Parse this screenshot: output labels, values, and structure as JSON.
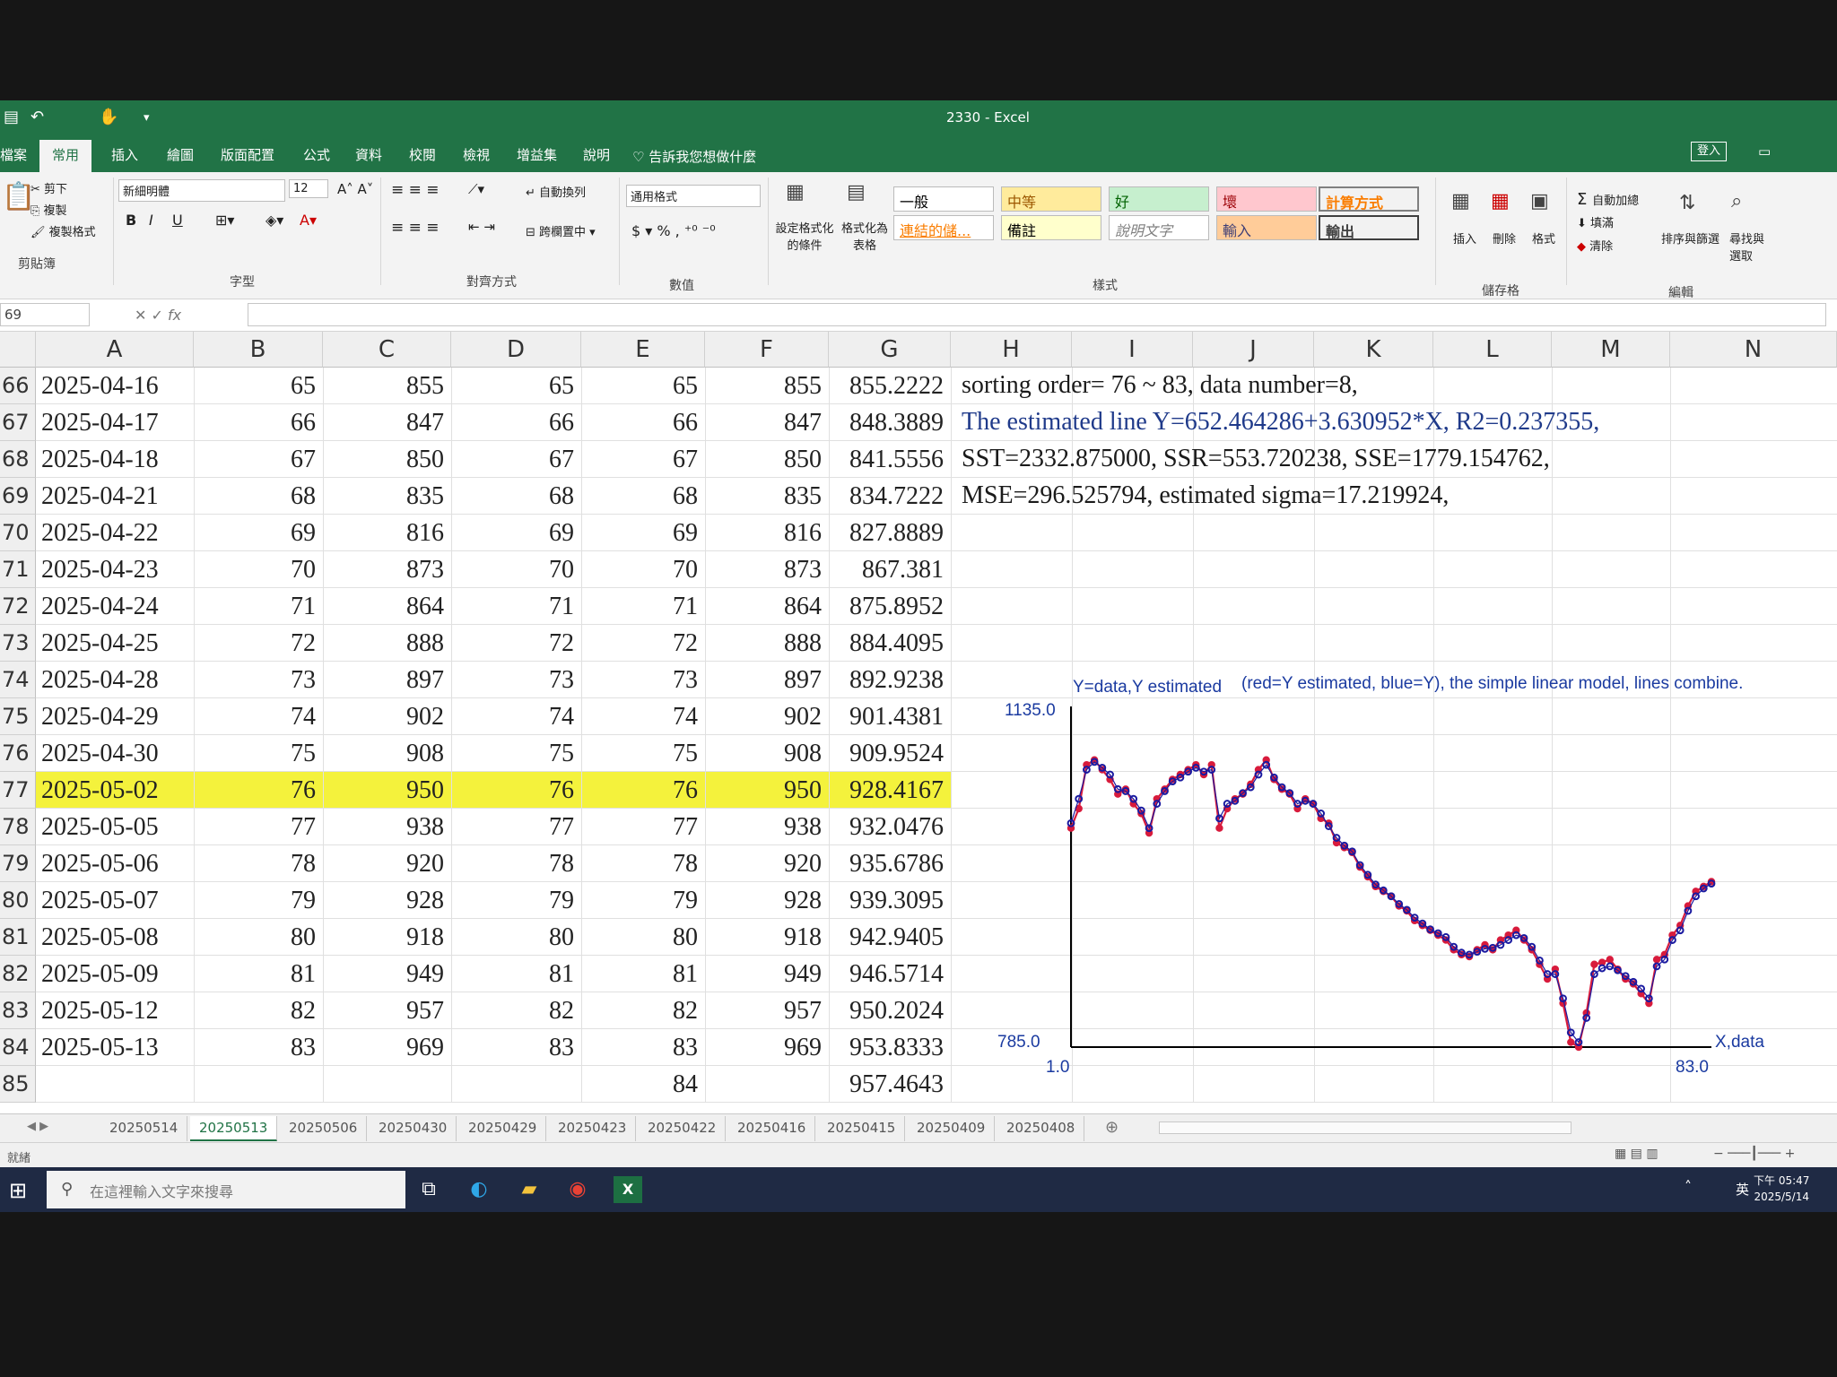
{
  "title_bar": {
    "title": "2330  -  Excel",
    "login": "登入"
  },
  "ribbon_tabs": [
    "檔案",
    "常用",
    "插入",
    "繪圖",
    "版面配置",
    "公式",
    "資料",
    "校閱",
    "檢視",
    "增益集",
    "說明"
  ],
  "tell_me": "告訴我您想做什麼",
  "clipboard": {
    "cut": "剪下",
    "copy": "複製",
    "format_painter": "複製格式",
    "label": "剪貼簿"
  },
  "font": {
    "name": "新細明體",
    "size": "12",
    "label": "字型"
  },
  "alignment": {
    "wrap": "自動換列",
    "merge": "跨欄置中",
    "label": "對齊方式"
  },
  "number": {
    "format": "通用格式",
    "label": "數值"
  },
  "styles": {
    "cond_format": "設定格式化的條件",
    "format_table": "格式化為表格",
    "cells": [
      "一般",
      "中等",
      "好",
      "壞",
      "計算方式",
      "連結的儲...",
      "備註",
      "說明文字",
      "輸入",
      "輸出"
    ],
    "label": "樣式"
  },
  "cells_group": {
    "insert": "插入",
    "delete": "刪除",
    "format": "格式",
    "label": "儲存格"
  },
  "editing": {
    "autosum": "自動加總",
    "fill": "填滿",
    "clear": "清除",
    "sort": "排序與篩選",
    "find": "尋找與選取",
    "label": "編輯"
  },
  "name_box": "69",
  "columns": [
    "A",
    "B",
    "C",
    "D",
    "E",
    "F",
    "G",
    "H",
    "I",
    "J",
    "K",
    "L",
    "M",
    "N"
  ],
  "rows": [
    {
      "n": "66",
      "a": "2025-04-16",
      "b": "65",
      "c": "855",
      "d": "65",
      "e": "65",
      "f": "855",
      "g": "855.2222"
    },
    {
      "n": "67",
      "a": "2025-04-17",
      "b": "66",
      "c": "847",
      "d": "66",
      "e": "66",
      "f": "847",
      "g": "848.3889"
    },
    {
      "n": "68",
      "a": "2025-04-18",
      "b": "67",
      "c": "850",
      "d": "67",
      "e": "67",
      "f": "850",
      "g": "841.5556"
    },
    {
      "n": "69",
      "a": "2025-04-21",
      "b": "68",
      "c": "835",
      "d": "68",
      "e": "68",
      "f": "835",
      "g": "834.7222"
    },
    {
      "n": "70",
      "a": "2025-04-22",
      "b": "69",
      "c": "816",
      "d": "69",
      "e": "69",
      "f": "816",
      "g": "827.8889"
    },
    {
      "n": "71",
      "a": "2025-04-23",
      "b": "70",
      "c": "873",
      "d": "70",
      "e": "70",
      "f": "873",
      "g": "867.381"
    },
    {
      "n": "72",
      "a": "2025-04-24",
      "b": "71",
      "c": "864",
      "d": "71",
      "e": "71",
      "f": "864",
      "g": "875.8952"
    },
    {
      "n": "73",
      "a": "2025-04-25",
      "b": "72",
      "c": "888",
      "d": "72",
      "e": "72",
      "f": "888",
      "g": "884.4095"
    },
    {
      "n": "74",
      "a": "2025-04-28",
      "b": "73",
      "c": "897",
      "d": "73",
      "e": "73",
      "f": "897",
      "g": "892.9238"
    },
    {
      "n": "75",
      "a": "2025-04-29",
      "b": "74",
      "c": "902",
      "d": "74",
      "e": "74",
      "f": "902",
      "g": "901.4381"
    },
    {
      "n": "76",
      "a": "2025-04-30",
      "b": "75",
      "c": "908",
      "d": "75",
      "e": "75",
      "f": "908",
      "g": "909.9524"
    },
    {
      "n": "77",
      "a": "2025-05-02",
      "b": "76",
      "c": "950",
      "d": "76",
      "e": "76",
      "f": "950",
      "g": "928.4167"
    },
    {
      "n": "78",
      "a": "2025-05-05",
      "b": "77",
      "c": "938",
      "d": "77",
      "e": "77",
      "f": "938",
      "g": "932.0476"
    },
    {
      "n": "79",
      "a": "2025-05-06",
      "b": "78",
      "c": "920",
      "d": "78",
      "e": "78",
      "f": "920",
      "g": "935.6786"
    },
    {
      "n": "80",
      "a": "2025-05-07",
      "b": "79",
      "c": "928",
      "d": "79",
      "e": "79",
      "f": "928",
      "g": "939.3095"
    },
    {
      "n": "81",
      "a": "2025-05-08",
      "b": "80",
      "c": "918",
      "d": "80",
      "e": "80",
      "f": "918",
      "g": "942.9405"
    },
    {
      "n": "82",
      "a": "2025-05-09",
      "b": "81",
      "c": "949",
      "d": "81",
      "e": "81",
      "f": "949",
      "g": "946.5714"
    },
    {
      "n": "83",
      "a": "2025-05-12",
      "b": "82",
      "c": "957",
      "d": "82",
      "e": "82",
      "f": "957",
      "g": "950.2024"
    },
    {
      "n": "84",
      "a": "2025-05-13",
      "b": "83",
      "c": "969",
      "d": "83",
      "e": "83",
      "f": "969",
      "g": "953.8333"
    },
    {
      "n": "85",
      "a": "",
      "b": "",
      "c": "",
      "d": "",
      "e": "84",
      "f": "",
      "g": "957.4643"
    }
  ],
  "highlight_row": "77",
  "highlight_color": "#f4f23c",
  "notes": [
    "sorting order= 76 ~ 83, data number=8,",
    "The estimated line Y=652.464286+3.630952*X, R2=0.237355,",
    "SST=2332.875000, SSR=553.720238, SSE=1779.154762,",
    "MSE=296.525794, estimated sigma=17.219924,"
  ],
  "note_colors": [
    "#1a1a1a",
    "#1f3a8a",
    "#1a1a1a",
    "#1a1a1a"
  ],
  "chart_data": {
    "type": "line",
    "title": "(red=Y estimated, blue=Y), the simple linear model, lines combine.",
    "ylabel": "Y=data,Y estimated",
    "xlabel": "X,data",
    "xlim": [
      1.0,
      83.0
    ],
    "ylim": [
      785.0,
      1135.0
    ],
    "y_top_label": "1135.0",
    "y_bottom_label": "785.0",
    "x_left_label": "1.0",
    "x_right_label": "83.0",
    "series_colors": {
      "estimated": "#d81b3c",
      "data": "#1a1aa0"
    },
    "series": [
      {
        "values": [
          1010,
          1030,
          1075,
          1080,
          1070,
          1060,
          1045,
          1050,
          1035,
          1025,
          1005,
          1040,
          1050,
          1060,
          1065,
          1070,
          1075,
          1065,
          1075,
          1010,
          1030,
          1040,
          1045,
          1055,
          1070,
          1080,
          1060,
          1050,
          1045,
          1030,
          1040,
          1035,
          1020,
          1015,
          995,
          990,
          985,
          970,
          960,
          950,
          945,
          940,
          930,
          925,
          915,
          910,
          905,
          900,
          895,
          885,
          880,
          878,
          885,
          890,
          885,
          895,
          900,
          905,
          895,
          885,
          870,
          855,
          865,
          830,
          790,
          785,
          820,
          870,
          872,
          875,
          865,
          855,
          850,
          840,
          830,
          875,
          880,
          900,
          910,
          930,
          945,
          950,
          955
        ]
      },
      {
        "values": [
          1015,
          1040,
          1070,
          1078,
          1072,
          1065,
          1050,
          1048,
          1040,
          1028,
          1010,
          1035,
          1048,
          1058,
          1062,
          1068,
          1072,
          1068,
          1070,
          1020,
          1035,
          1038,
          1046,
          1052,
          1065,
          1075,
          1062,
          1052,
          1046,
          1035,
          1038,
          1035,
          1025,
          1012,
          1000,
          992,
          986,
          972,
          962,
          952,
          946,
          940,
          932,
          926,
          918,
          912,
          906,
          902,
          898,
          888,
          882,
          880,
          883,
          886,
          887,
          890,
          895,
          900,
          897,
          888,
          874,
          860,
          860,
          835,
          800,
          790,
          815,
          860,
          866,
          868,
          864,
          858,
          852,
          845,
          835,
          868,
          875,
          895,
          905,
          925,
          940,
          948,
          953
        ]
      }
    ]
  },
  "sheet_tabs": [
    "20250514",
    "20250513",
    "20250506",
    "20250430",
    "20250429",
    "20250423",
    "20250422",
    "20250416",
    "20250415",
    "20250409",
    "20250408"
  ],
  "active_sheet": "20250513",
  "status": "就緒",
  "taskbar": {
    "search": "在這裡輸入文字來搜尋",
    "ime": "英",
    "time": "下午 05:47",
    "date": "2025/5/14"
  }
}
